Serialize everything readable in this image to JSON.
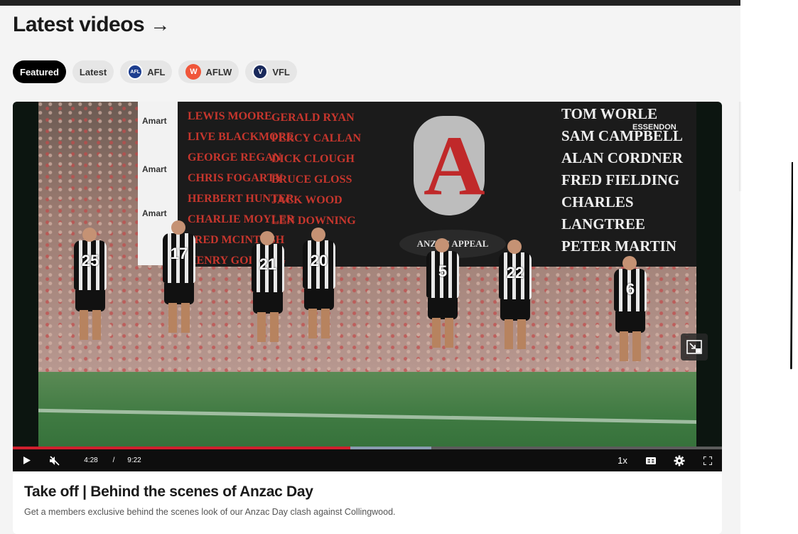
{
  "section": {
    "title": "Latest videos",
    "arrow": "→"
  },
  "filters": [
    {
      "label": "Featured",
      "logo": ""
    },
    {
      "label": "Latest",
      "logo": ""
    },
    {
      "label": "AFL",
      "logo": "AFL"
    },
    {
      "label": "AFLW",
      "logo": "W"
    },
    {
      "label": "VFL",
      "logo": "V"
    }
  ],
  "video": {
    "banner_names_left": [
      "LEWIS MOORE",
      "LIVE BLACKMORE",
      "GEORGE REGAN",
      "CHRIS FOGARTY",
      "HERBERT HUNTER",
      "CHARLIE MOYLER",
      "FRED MCINTOSH",
      "HENRY GOLDING"
    ],
    "banner_names_mid": [
      "GERALD RYAN",
      "PERCY CALLAN",
      "DICK CLOUGH",
      "BRUCE GLOSS",
      "JACK WOOD",
      "LEN DOWNING"
    ],
    "banner_names_right": [
      "TOM WORLE",
      "SAM CAMPBELL",
      "ALAN CORDNER",
      "FRED FIELDING",
      "CHARLES LANGTREE",
      "PETER MARTIN"
    ],
    "banner_club": "ESSENDON",
    "banner_scroll": "ANZAC APPEAL",
    "sponsor": "Amart",
    "player_numbers": [
      "25",
      "17",
      "21",
      "20",
      "5",
      "22",
      "6"
    ],
    "current_time": "4:28",
    "separator": "/",
    "duration": "9:22",
    "speed": "1x",
    "progress_played": 0.476,
    "progress_buffered": 0.59,
    "colors": {
      "played": "#d0202e",
      "buffer": "#8a9bb0"
    }
  },
  "card": {
    "title": "Take off | Behind the scenes of Anzac Day",
    "description": "Get a members exclusive behind the scenes look of our Anzac Day clash against Collingwood."
  }
}
